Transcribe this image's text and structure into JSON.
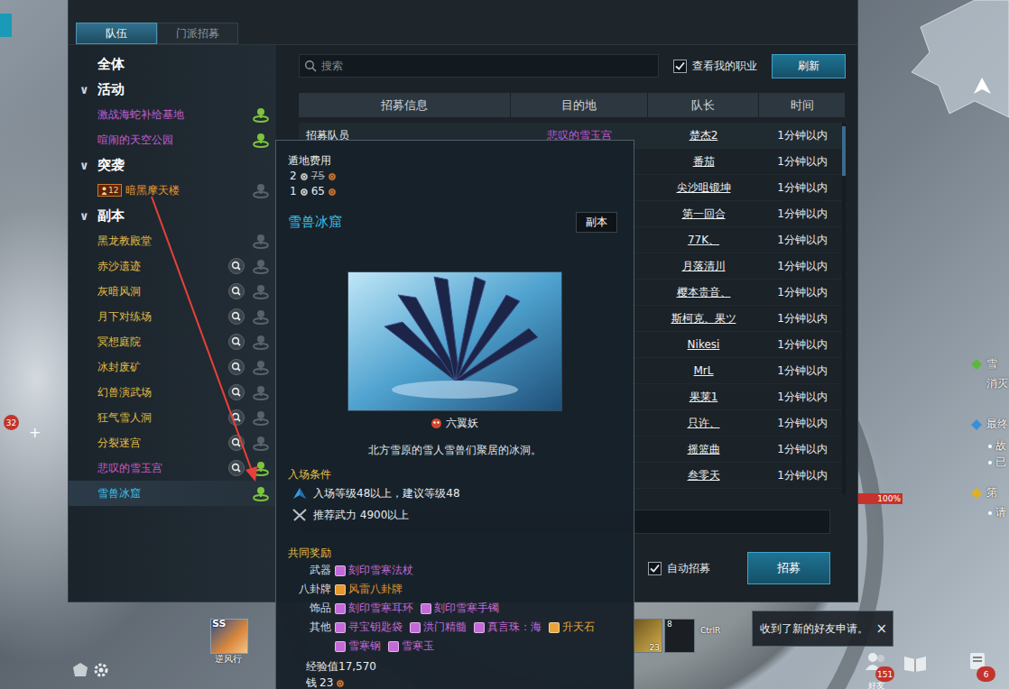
{
  "tabs": [
    {
      "label": "队伍",
      "selected": true
    },
    {
      "label": "门派招募",
      "selected": false
    }
  ],
  "sidebar": {
    "all": {
      "label": "全体"
    },
    "groups": [
      {
        "label": "活动",
        "chevron": "∨",
        "expanded": true,
        "items": [
          {
            "label": "激战海蛇补给基地",
            "color": "#c25fd6",
            "searchable": false,
            "recruiting": true,
            "selected": false
          },
          {
            "label": "喧闹的天空公园",
            "color": "#c25fd6",
            "searchable": false,
            "recruiting": true,
            "selected": false
          }
        ]
      },
      {
        "label": "突袭",
        "chevron": "∨",
        "expanded": true,
        "items": [
          {
            "label": "暗黑摩天楼",
            "color": "#e8962e",
            "badge": "12",
            "searchable": false,
            "recruiting": false,
            "selected": false
          }
        ]
      },
      {
        "label": "副本",
        "chevron": "∨",
        "expanded": true,
        "items": [
          {
            "label": "黑龙教殿堂",
            "color": "#e2bd45",
            "searchable": false,
            "recruiting": false,
            "selected": false
          },
          {
            "label": "赤沙遗迹",
            "color": "#e2bd45",
            "searchable": true,
            "recruiting": false,
            "selected": false
          },
          {
            "label": "灰暗风洞",
            "color": "#e2bd45",
            "searchable": true,
            "recruiting": false,
            "selected": false
          },
          {
            "label": "月下对练场",
            "color": "#e2bd45",
            "searchable": true,
            "recruiting": false,
            "selected": false
          },
          {
            "label": "冥想庭院",
            "color": "#e2bd45",
            "searchable": true,
            "recruiting": false,
            "selected": false
          },
          {
            "label": "冰封废矿",
            "color": "#e2bd45",
            "searchable": true,
            "recruiting": false,
            "selected": false
          },
          {
            "label": "幻兽演武场",
            "color": "#e2bd45",
            "searchable": true,
            "recruiting": false,
            "selected": false
          },
          {
            "label": "狂气雪人洞",
            "color": "#e2bd45",
            "searchable": true,
            "recruiting": false,
            "selected": false
          },
          {
            "label": "分裂迷宫",
            "color": "#e2bd45",
            "searchable": true,
            "recruiting": false,
            "selected": false
          },
          {
            "label": "悲叹的雪玉宫",
            "color": "#c85ccf",
            "searchable": true,
            "recruiting": true,
            "selected": false
          },
          {
            "label": "雪兽冰窟",
            "color": "#3fc6ee",
            "searchable": false,
            "recruiting": true,
            "selected": true
          }
        ]
      }
    ]
  },
  "search": {
    "placeholder": "搜索"
  },
  "my_class_filter": {
    "label": "查看我的职业",
    "checked": true
  },
  "refresh_button": "刷新",
  "table": {
    "columns": [
      "招募信息",
      "目的地",
      "队长",
      "时间"
    ],
    "rows": [
      {
        "info": "招募队员",
        "destination": "悲叹的雪玉宫",
        "leader": "楚杰2",
        "time": "1分钟以内"
      },
      {
        "leader": "番茄",
        "time": "1分钟以内"
      },
      {
        "leader": "尖沙咀锻坤",
        "time": "1分钟以内"
      },
      {
        "leader": "第一回合",
        "time": "1分钟以内"
      },
      {
        "leader": "77K、",
        "time": "1分钟以内"
      },
      {
        "leader": "月落清川",
        "time": "1分钟以内"
      },
      {
        "leader": "樱本贵音、",
        "time": "1分钟以内"
      },
      {
        "leader": "斯柯克、果ツ",
        "time": "1分钟以内"
      },
      {
        "leader": "Nikesi",
        "time": "1分钟以内"
      },
      {
        "leader": "MrL",
        "time": "1分钟以内"
      },
      {
        "leader": "果莱1",
        "time": "1分钟以内"
      },
      {
        "leader": "只许、",
        "time": "1分钟以内"
      },
      {
        "leader": "摇篮曲",
        "time": "1分钟以内"
      },
      {
        "leader": "叁零天",
        "time": "1分钟以内"
      }
    ]
  },
  "auto_recruit": {
    "label": "自动招募",
    "checked": true
  },
  "recruit_button": "招募",
  "tooltip": {
    "fee": {
      "label": "遁地费用",
      "options": [
        {
          "count": "2",
          "amount": "75",
          "struck": true
        },
        {
          "count": "1",
          "amount": "65",
          "struck": false
        }
      ]
    },
    "title": "雪兽冰窟",
    "tag": "副本",
    "boss": "六翼妖",
    "description": "北方雪原的雪人雪兽们聚居的冰洞。",
    "requirements": {
      "heading": "入场条件",
      "lines": [
        {
          "text": "入场等级48以上，建议等级48",
          "kind": "level"
        },
        {
          "text": "推荐武力 4900以上",
          "kind": "power"
        }
      ]
    },
    "rewards": {
      "heading": "共同奖励",
      "groups": [
        {
          "label": "武器",
          "items": [
            {
              "name": "刻印雪寒法杖",
              "color": "#c46ad8"
            }
          ]
        },
        {
          "label": "八卦牌",
          "items": [
            {
              "name": "风雷八卦牌",
              "color": "#e8962e"
            }
          ]
        },
        {
          "label": "饰品",
          "items": [
            {
              "name": "刻印雪寒耳环",
              "color": "#c46ad8"
            },
            {
              "name": "刻印雪寒手镯",
              "color": "#c46ad8"
            }
          ]
        },
        {
          "label": "其他",
          "items": [
            {
              "name": "寻宝钥匙袋",
              "color": "#c46ad8"
            },
            {
              "name": "洪门精髓",
              "color": "#c46ad8"
            },
            {
              "name": "真言珠：海",
              "color": "#c46ad8"
            },
            {
              "name": "升天石",
              "color": "#e8a43a"
            },
            {
              "name": "雪寒钢",
              "color": "#c46ad8"
            },
            {
              "name": "雪寒玉",
              "color": "#c46ad8"
            }
          ]
        }
      ]
    },
    "exp": {
      "label": "经验值",
      "value": "17,570"
    },
    "money": {
      "label": "钱",
      "value": "23"
    }
  },
  "hud": {
    "skill": {
      "badge": "SS",
      "label": "逆风行"
    },
    "left_badge": "32",
    "left_plus": "+",
    "hotbar": [
      {
        "count": "23"
      },
      {
        "count": "8"
      }
    ],
    "hotkey": "CtrlR",
    "notification": {
      "text": "收到了新的好友申请。",
      "close": "×"
    },
    "quest": [
      {
        "text": "雪",
        "kind": "title",
        "color": "#5cb83a"
      },
      {
        "text": "消灭",
        "kind": "line"
      },
      {
        "text": "最终",
        "kind": "title",
        "color": "#3a8fd8"
      },
      {
        "text": "故",
        "kind": "bullet"
      },
      {
        "text": "已",
        "kind": "bullet"
      },
      {
        "text": "第",
        "kind": "title",
        "color": "#e0b020"
      },
      {
        "text": "请",
        "kind": "bullet"
      }
    ],
    "health": {
      "level": 1,
      "reading": "100%"
    },
    "menu": [
      {
        "count": "151",
        "label": "好友"
      },
      {
        "count": "6"
      }
    ]
  }
}
